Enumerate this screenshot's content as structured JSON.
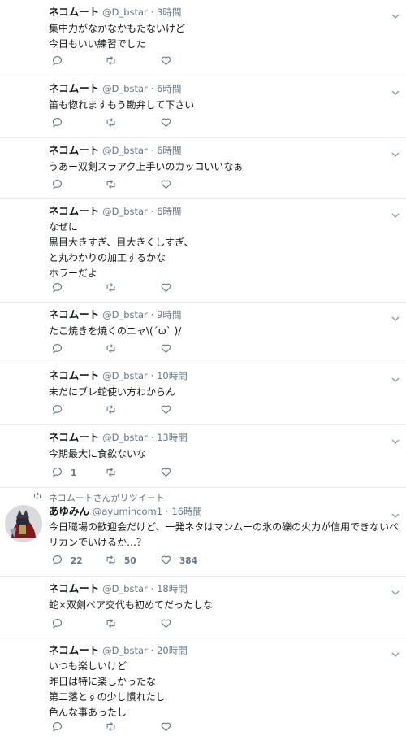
{
  "tweets": [
    {
      "name": "ネコムート",
      "handle": "@D_bstar",
      "dot": "·",
      "time": "3時間",
      "text": "集中力がなかなかもたないけど\n今日もいい練習でした",
      "reply_count": "",
      "rt_count": "",
      "like_count": ""
    },
    {
      "name": "ネコムート",
      "handle": "@D_bstar",
      "dot": "·",
      "time": "6時間",
      "text": "笛も惚れますもう勘弁して下さい",
      "reply_count": "",
      "rt_count": "",
      "like_count": ""
    },
    {
      "name": "ネコムート",
      "handle": "@D_bstar",
      "dot": "·",
      "time": "6時間",
      "text": "うあー双剣スラアク上手いのカッコいいなぁ",
      "reply_count": "",
      "rt_count": "",
      "like_count": ""
    },
    {
      "name": "ネコムート",
      "handle": "@D_bstar",
      "dot": "·",
      "time": "6時間",
      "text": "なぜに\n黒目大きすぎ、目大きくしすぎ、\nと丸わかりの加工するかな\nホラーだよ",
      "reply_count": "",
      "rt_count": "",
      "like_count": ""
    },
    {
      "name": "ネコムート",
      "handle": "@D_bstar",
      "dot": "·",
      "time": "9時間",
      "text": "たこ焼きを焼くのニャ\\(´ω` )/",
      "reply_count": "",
      "rt_count": "",
      "like_count": ""
    },
    {
      "name": "ネコムート",
      "handle": "@D_bstar",
      "dot": "·",
      "time": "10時間",
      "text": "未だにブレ蛇使い方わからん",
      "reply_count": "",
      "rt_count": "",
      "like_count": ""
    },
    {
      "name": "ネコムート",
      "handle": "@D_bstar",
      "dot": "·",
      "time": "13時間",
      "text": "今期最大に食欲ないな",
      "reply_count": "1",
      "rt_count": "",
      "like_count": ""
    },
    {
      "retweeted_by": "ネコムートさんがリツイート",
      "name": "あゆみん",
      "handle": "@ayumincom1",
      "dot": "·",
      "time": "16時間",
      "text": "今日職場の歓迎会だけど、一発ネタはマンムーの氷の礫の火力が信用できないペリカンでいけるか…？",
      "reply_count": "22",
      "rt_count": "50",
      "like_count": "384"
    },
    {
      "name": "ネコムート",
      "handle": "@D_bstar",
      "dot": "·",
      "time": "18時間",
      "text": "蛇×双剣ペア交代も初めてだったしな",
      "reply_count": "",
      "rt_count": "",
      "like_count": ""
    },
    {
      "name": "ネコムート",
      "handle": "@D_bstar",
      "dot": "·",
      "time": "20時間",
      "text": "いつも楽しいけど\n昨日は特に楽しかったな\n第二落とすの少し慣れたし\n色んな事あったし",
      "reply_count": "",
      "rt_count": "",
      "like_count": ""
    }
  ]
}
